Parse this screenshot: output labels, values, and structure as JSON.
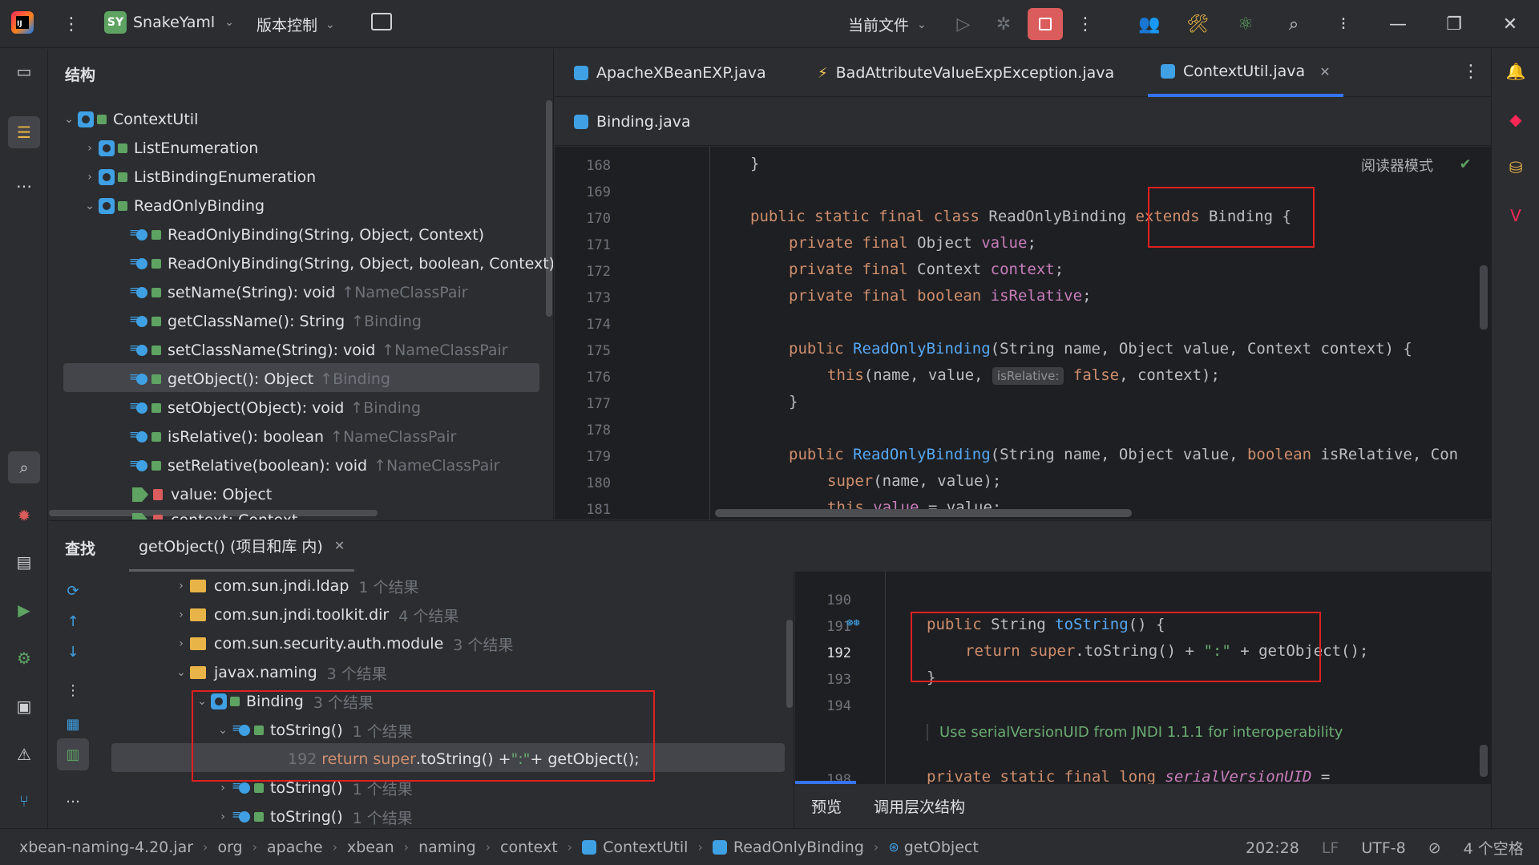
{
  "titlebar": {
    "project_initials": "SY",
    "project_name": "SnakeYaml",
    "vcs_label": "版本控制",
    "run_config": "当前文件"
  },
  "structure": {
    "title": "结构",
    "items": [
      {
        "label": "ContextUtil",
        "inherit": ""
      },
      {
        "label": "ListEnumeration",
        "inherit": ""
      },
      {
        "label": "ListBindingEnumeration",
        "inherit": ""
      },
      {
        "label": "ReadOnlyBinding",
        "inherit": ""
      },
      {
        "label": "ReadOnlyBinding(String, Object, Context)",
        "inherit": ""
      },
      {
        "label": "ReadOnlyBinding(String, Object, boolean, Context)",
        "inherit": ""
      },
      {
        "label": "setName(String): void",
        "inherit": "↑NameClassPair"
      },
      {
        "label": "getClassName(): String",
        "inherit": "↑Binding"
      },
      {
        "label": "setClassName(String): void",
        "inherit": "↑NameClassPair"
      },
      {
        "label": "getObject(): Object",
        "inherit": "↑Binding"
      },
      {
        "label": "setObject(Object): void",
        "inherit": "↑Binding"
      },
      {
        "label": "isRelative(): boolean",
        "inherit": "↑NameClassPair"
      },
      {
        "label": "setRelative(boolean): void",
        "inherit": "↑NameClassPair"
      },
      {
        "label": "value: Object",
        "inherit": ""
      },
      {
        "label": "context: Context",
        "inherit": ""
      }
    ]
  },
  "editor": {
    "tabs": [
      "ApacheXBeanEXP.java",
      "BadAttributeValueExpException.java",
      "ContextUtil.java",
      "Binding.java"
    ],
    "reader_mode": "阅读器模式",
    "inlay_hint": "isRelative:",
    "lines": [
      {
        "n": "168",
        "code": "}"
      },
      {
        "n": "169",
        "code": ""
      },
      {
        "n": "170",
        "code": "public static final class ReadOnlyBinding extends Binding {"
      },
      {
        "n": "171",
        "code": "private final Object value;"
      },
      {
        "n": "172",
        "code": "private final Context context;"
      },
      {
        "n": "173",
        "code": "private final boolean isRelative;"
      },
      {
        "n": "174",
        "code": ""
      },
      {
        "n": "175",
        "code": "public ReadOnlyBinding(String name, Object value, Context context) {"
      },
      {
        "n": "176",
        "code": "this(name, value, false, context);"
      },
      {
        "n": "177",
        "code": "}"
      },
      {
        "n": "178",
        "code": ""
      },
      {
        "n": "179",
        "code": "public ReadOnlyBinding(String name, Object value, boolean isRelative, Con"
      },
      {
        "n": "180",
        "code": "super(name, value);"
      },
      {
        "n": "181",
        "code": "this.value = value;"
      }
    ]
  },
  "find": {
    "title": "查找",
    "tab_label": "getObject() (项目和库 内)",
    "tree": [
      {
        "label": "com.sun.jndi.ldap",
        "count": "1 个结果"
      },
      {
        "label": "com.sun.jndi.toolkit.dir",
        "count": "4 个结果"
      },
      {
        "label": "com.sun.security.auth.module",
        "count": "3 个结果"
      },
      {
        "label": "javax.naming",
        "count": "3 个结果"
      },
      {
        "label": "Binding",
        "count": "3 个结果"
      },
      {
        "label": "toString()",
        "count": "1 个结果"
      },
      {
        "label": "192 return super.toString() + \":\" + getObject();",
        "count": ""
      },
      {
        "label": "toString()",
        "count": "1 个结果"
      },
      {
        "label": "toString()",
        "count": "1 个结果"
      }
    ]
  },
  "preview": {
    "lines": [
      {
        "n": "190",
        "code": ""
      },
      {
        "n": "191",
        "code": "public String toString() {"
      },
      {
        "n": "192",
        "code": "return super.toString() + \":\" + getObject();"
      },
      {
        "n": "193",
        "code": "}"
      },
      {
        "n": "194",
        "code": ""
      },
      {
        "n": "",
        "code": "Use serialVersionUID from JNDI 1.1.1 for interoperability"
      },
      {
        "n": "198",
        "code": "private static final long serialVersionUID ="
      }
    ],
    "tabs": [
      "预览",
      "调用层次结构"
    ]
  },
  "statusbar": {
    "crumbs": [
      "xbean-naming-4.20.jar",
      "org",
      "apache",
      "xbean",
      "naming",
      "context",
      "ContextUtil",
      "ReadOnlyBinding",
      "getObject"
    ],
    "position": "202:28",
    "line_sep": "LF",
    "encoding": "UTF-8",
    "indent": "4 个空格"
  }
}
